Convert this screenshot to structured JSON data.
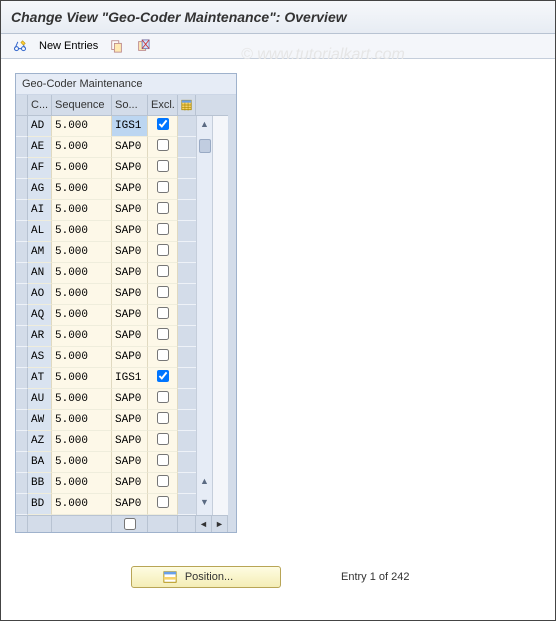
{
  "title": "Change View \"Geo-Coder Maintenance\": Overview",
  "watermark": "© www.tutorialkart.com",
  "toolbar": {
    "new_entries_label": "New Entries"
  },
  "panel": {
    "title": "Geo-Coder Maintenance",
    "columns": {
      "country": "C...",
      "sequence": "Sequence",
      "source": "So...",
      "excl": "Excl."
    }
  },
  "rows": [
    {
      "c": "AD",
      "seq": "5.000",
      "so": "IGS1",
      "excl": true,
      "so_selected": true
    },
    {
      "c": "AE",
      "seq": "5.000",
      "so": "SAP0",
      "excl": false,
      "so_selected": false
    },
    {
      "c": "AF",
      "seq": "5.000",
      "so": "SAP0",
      "excl": false,
      "so_selected": false
    },
    {
      "c": "AG",
      "seq": "5.000",
      "so": "SAP0",
      "excl": false,
      "so_selected": false
    },
    {
      "c": "AI",
      "seq": "5.000",
      "so": "SAP0",
      "excl": false,
      "so_selected": false
    },
    {
      "c": "AL",
      "seq": "5.000",
      "so": "SAP0",
      "excl": false,
      "so_selected": false
    },
    {
      "c": "AM",
      "seq": "5.000",
      "so": "SAP0",
      "excl": false,
      "so_selected": false
    },
    {
      "c": "AN",
      "seq": "5.000",
      "so": "SAP0",
      "excl": false,
      "so_selected": false
    },
    {
      "c": "AO",
      "seq": "5.000",
      "so": "SAP0",
      "excl": false,
      "so_selected": false
    },
    {
      "c": "AQ",
      "seq": "5.000",
      "so": "SAP0",
      "excl": false,
      "so_selected": false
    },
    {
      "c": "AR",
      "seq": "5.000",
      "so": "SAP0",
      "excl": false,
      "so_selected": false
    },
    {
      "c": "AS",
      "seq": "5.000",
      "so": "SAP0",
      "excl": false,
      "so_selected": false
    },
    {
      "c": "AT",
      "seq": "5.000",
      "so": "IGS1",
      "excl": true,
      "so_selected": false
    },
    {
      "c": "AU",
      "seq": "5.000",
      "so": "SAP0",
      "excl": false,
      "so_selected": false
    },
    {
      "c": "AW",
      "seq": "5.000",
      "so": "SAP0",
      "excl": false,
      "so_selected": false
    },
    {
      "c": "AZ",
      "seq": "5.000",
      "so": "SAP0",
      "excl": false,
      "so_selected": false
    },
    {
      "c": "BA",
      "seq": "5.000",
      "so": "SAP0",
      "excl": false,
      "so_selected": false
    },
    {
      "c": "BB",
      "seq": "5.000",
      "so": "SAP0",
      "excl": false,
      "so_selected": false
    },
    {
      "c": "BD",
      "seq": "5.000",
      "so": "SAP0",
      "excl": false,
      "so_selected": false
    }
  ],
  "footer": {
    "position_label": "Position...",
    "entry_status": "Entry 1 of 242"
  }
}
